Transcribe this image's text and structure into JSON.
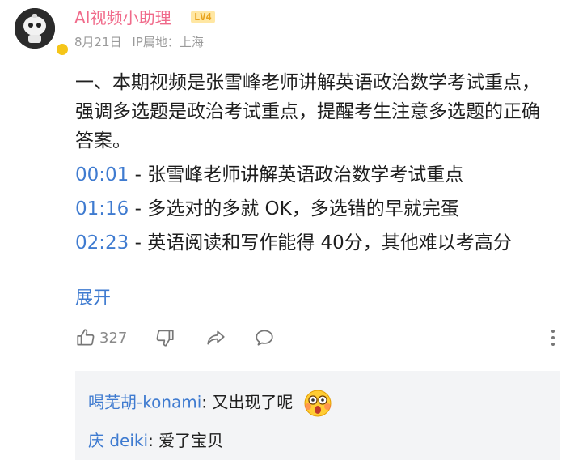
{
  "author": {
    "name": "AI视频小助理",
    "level": "LV4",
    "date": "8月21日",
    "ip_location": "IP属地：上海"
  },
  "post": {
    "summary": "一、本期视频是张雪峰老师讲解英语政治数学考试重点，强调多选题是政治考试重点，提醒考生注意多选题的正确答案。",
    "chapters": [
      {
        "time": "00:01",
        "text": " - 张雪峰老师讲解英语政治数学考试重点"
      },
      {
        "time": "01:16",
        "text": " - 多选对的多就 OK，多选错的早就完蛋"
      },
      {
        "time": "02:23",
        "text": " - 英语阅读和写作能得 40分，其他难以考高分"
      }
    ],
    "expand_label": "展开"
  },
  "actions": {
    "like_count": "327",
    "icons": [
      "thumbs-up-icon",
      "thumbs-down-icon",
      "share-icon",
      "comment-icon",
      "more-vertical-icon"
    ]
  },
  "replies": [
    {
      "user": "喝芜胡-konami",
      "text": ": 又出现了呢"
    },
    {
      "user": "庆 deiki",
      "text": ": 爱了宝贝"
    }
  ],
  "colors": {
    "username": "#f06a8a",
    "link": "#3f7bd0",
    "meta": "#9a9a9a",
    "reply_bg": "#f3f4f6"
  }
}
